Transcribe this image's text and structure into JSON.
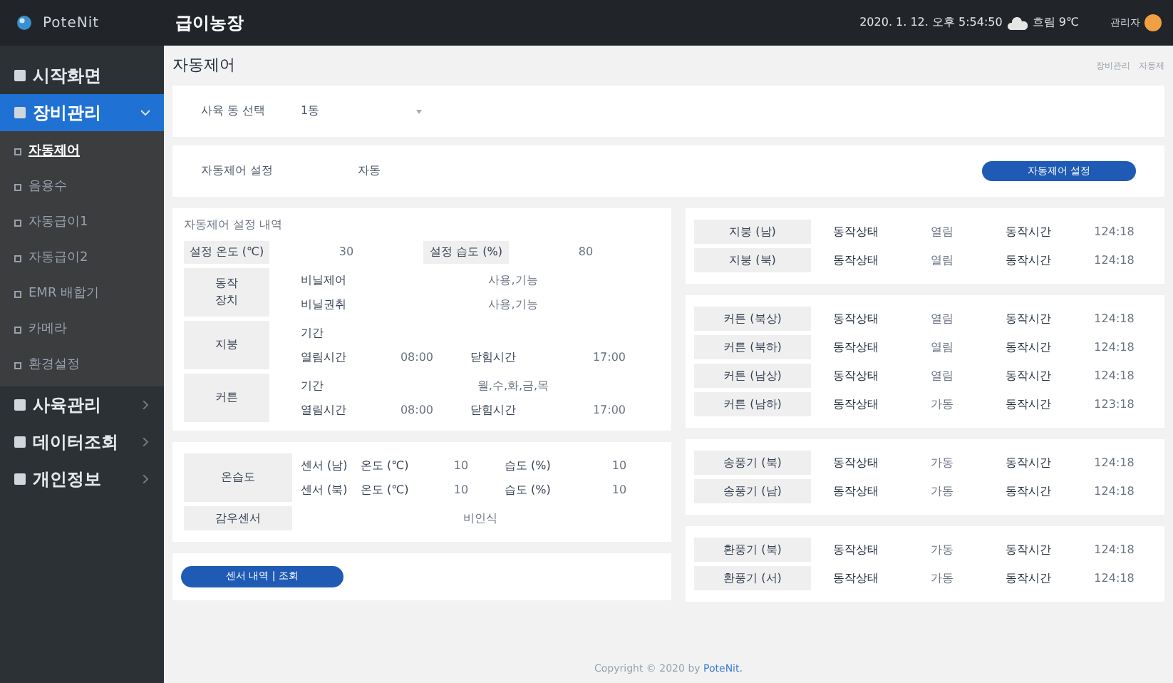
{
  "brand": "PoteNit",
  "header": {
    "title": "급이농장",
    "datetime": "2020. 1. 12. 오후 5:54:50",
    "weather": "흐림 9℃",
    "user": "관리자"
  },
  "sidebar": [
    {
      "label": "시작화면",
      "selected": false
    },
    {
      "label": "장비관리",
      "selected": true,
      "expanded": true,
      "children": [
        {
          "label": "자동제어",
          "selected": true
        },
        {
          "label": "음용수",
          "selected": false
        },
        {
          "label": "자동급이1",
          "selected": false
        },
        {
          "label": "자동급이2",
          "selected": false
        },
        {
          "label": "EMR 배합기",
          "selected": false
        },
        {
          "label": "카메라",
          "selected": false
        },
        {
          "label": "환경설정",
          "selected": false
        }
      ]
    },
    {
      "label": "사육관리",
      "selected": false,
      "expanded": false
    },
    {
      "label": "데이터조회",
      "selected": false,
      "expanded": false
    },
    {
      "label": "개인정보",
      "selected": false,
      "expanded": false
    }
  ],
  "page": {
    "title": "자동제어",
    "breadcrumb": [
      "장비관리",
      "자동제"
    ]
  },
  "barn_select": {
    "label": "사육 동 선택",
    "value": "1동"
  },
  "auto_control": {
    "label": "자동제어 설정",
    "value": "자동",
    "button": "자동제어 설정"
  },
  "settings": {
    "title": "자동제어 설정 내역",
    "temp_label": "설정 온도 (℃)",
    "temp_value": "30",
    "humid_label": "설정 습도 (%)",
    "humid_value": "80",
    "devices": {
      "label": "동작 장치",
      "rows": [
        {
          "name": "비닐제어",
          "value": "사용,기능"
        },
        {
          "name": "비닐권취",
          "value": "사용,기능"
        }
      ]
    },
    "roof": {
      "label": "지붕",
      "period_label": "기간",
      "open_label": "열림시간",
      "open_value": "08:00",
      "close_label": "닫힘시간",
      "close_value": "17:00"
    },
    "curtain": {
      "label": "커튼",
      "period_label": "기간",
      "period_value": "월,수,화,금,목",
      "open_label": "열림시간",
      "open_value": "08:00",
      "close_label": "닫힘시간",
      "close_value": "17:00"
    }
  },
  "sensors": {
    "label": "온습도",
    "rows": [
      {
        "name": "센서 (남)",
        "temp_label": "온도 (℃)",
        "temp": "10",
        "humid_label": "습도 (%)",
        "humid": "10"
      },
      {
        "name": "센서 (북)",
        "temp_label": "온도 (℃)",
        "temp": "10",
        "humid_label": "습도 (%)",
        "humid": "10"
      }
    ],
    "rain": {
      "label": "감우센서",
      "value": "비인식"
    },
    "button": "센서 내역 | 조회"
  },
  "status_groups": [
    [
      {
        "name": "지붕 (남)",
        "state_label": "동작상태",
        "state": "열림",
        "time_label": "동작시간",
        "time": "124:18"
      },
      {
        "name": "지붕 (북)",
        "state_label": "동작상태",
        "state": "열림",
        "time_label": "동작시간",
        "time": "124:18"
      }
    ],
    [
      {
        "name": "커튼 (북상)",
        "state_label": "동작상태",
        "state": "열림",
        "time_label": "동작시간",
        "time": "124:18"
      },
      {
        "name": "커튼 (북하)",
        "state_label": "동작상태",
        "state": "열림",
        "time_label": "동작시간",
        "time": "124:18"
      },
      {
        "name": "커튼 (남상)",
        "state_label": "동작상태",
        "state": "열림",
        "time_label": "동작시간",
        "time": "124:18"
      },
      {
        "name": "커튼 (남하)",
        "state_label": "동작상태",
        "state": "가동",
        "time_label": "동작시간",
        "time": "123:18"
      }
    ],
    [
      {
        "name": "송풍기 (북)",
        "state_label": "동작상태",
        "state": "가동",
        "time_label": "동작시간",
        "time": "124:18"
      },
      {
        "name": "송풍기 (남)",
        "state_label": "동작상태",
        "state": "가동",
        "time_label": "동작시간",
        "time": "124:18"
      }
    ],
    [
      {
        "name": "환풍기 (북)",
        "state_label": "동작상태",
        "state": "가동",
        "time_label": "동작시간",
        "time": "124:18"
      },
      {
        "name": "환풍기 (서)",
        "state_label": "동작상태",
        "state": "가동",
        "time_label": "동작시간",
        "time": "124:18"
      }
    ]
  ],
  "footer": {
    "text": "Copyright © 2020 by ",
    "link": "PoteNit."
  }
}
